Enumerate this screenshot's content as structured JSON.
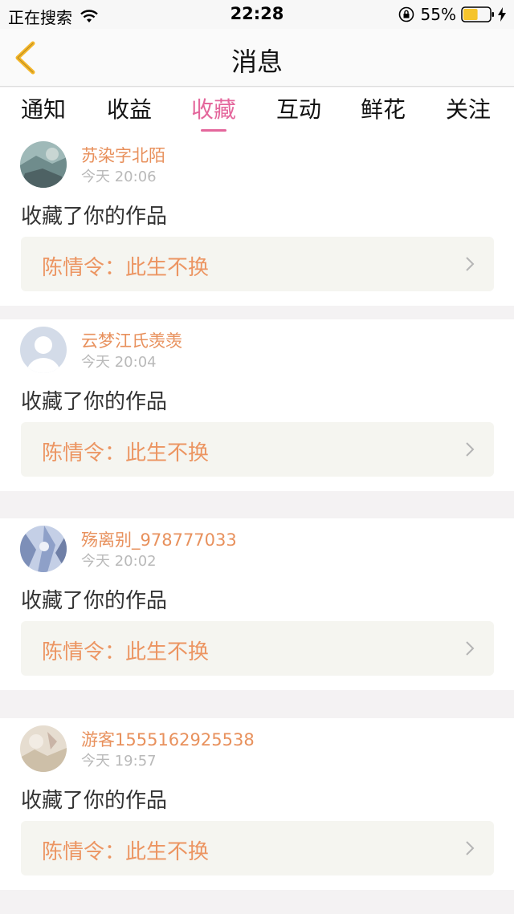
{
  "status_bar": {
    "carrier": "正在搜索",
    "time": "22:28",
    "battery": "55%",
    "battery_level": 0.55
  },
  "header": {
    "title": "消息"
  },
  "tabs": [
    {
      "label": "通知",
      "active": false
    },
    {
      "label": "收益",
      "active": false
    },
    {
      "label": "收藏",
      "active": true
    },
    {
      "label": "互动",
      "active": false
    },
    {
      "label": "鲜花",
      "active": false
    },
    {
      "label": "关注",
      "active": false
    }
  ],
  "items": [
    {
      "username": "苏染字北陌",
      "time": "今天 20:06",
      "action": "收藏了你的作品",
      "work": "陈情令：此生不换"
    },
    {
      "username": "云梦江氏羡羡",
      "time": "今天 20:04",
      "action": "收藏了你的作品",
      "work": "陈情令：此生不换"
    },
    {
      "username": "殇离别_978777033",
      "time": "今天 20:02",
      "action": "收藏了你的作品",
      "work": "陈情令：此生不换"
    },
    {
      "username": "游客1555162925538",
      "time": "今天 19:57",
      "action": "收藏了你的作品",
      "work": "陈情令：此生不换"
    }
  ],
  "colors": {
    "accent": "#e4679c",
    "username": "#e8915d",
    "work_title": "#ec9562",
    "back_arrow": "#f5b72a"
  }
}
